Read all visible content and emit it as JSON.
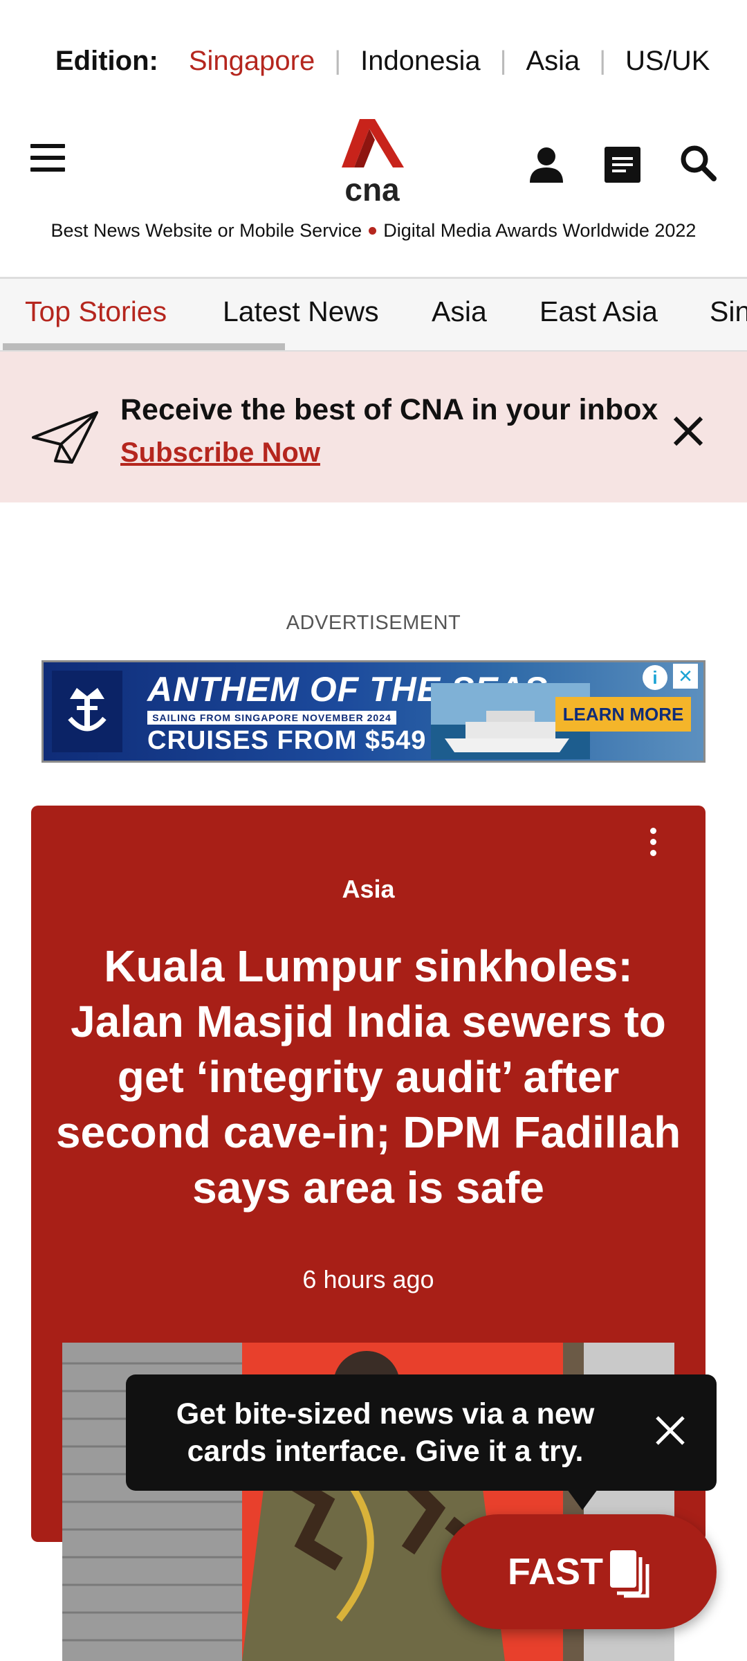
{
  "edition": {
    "label": "Edition:",
    "options": [
      "Singapore",
      "Indonesia",
      "Asia",
      "US/UK"
    ],
    "active": "Singapore"
  },
  "header": {
    "logo_text": "cna",
    "award_left": "Best News Website or Mobile Service",
    "award_right": "Digital Media Awards Worldwide 2022"
  },
  "tabs": [
    "Top Stories",
    "Latest News",
    "Asia",
    "East Asia",
    "Singapore"
  ],
  "newsletter": {
    "title": "Receive the best of CNA in your inbox",
    "link": "Subscribe Now"
  },
  "ad": {
    "label": "ADVERTISEMENT",
    "title": "ANTHEM OF THE SEAS",
    "subtitle": "SAILING FROM SINGAPORE NOVEMBER 2024",
    "price": "CRUISES FROM $549",
    "cta": "LEARN MORE"
  },
  "story": {
    "category": "Asia",
    "headline": "Kuala Lumpur sinkholes: Jalan Masjid India sewers to get ‘integrity audit’ after second cave-in; DPM Fadillah says area is safe",
    "time": "6 hours ago"
  },
  "tooltip": {
    "text": "Get bite-sized news via a new cards interface. Give it a try."
  },
  "fast": {
    "label": "FAST"
  },
  "colors": {
    "brand_red": "#a81f17",
    "active_red": "#b5261e",
    "banner_bg": "#f6e4e3"
  }
}
